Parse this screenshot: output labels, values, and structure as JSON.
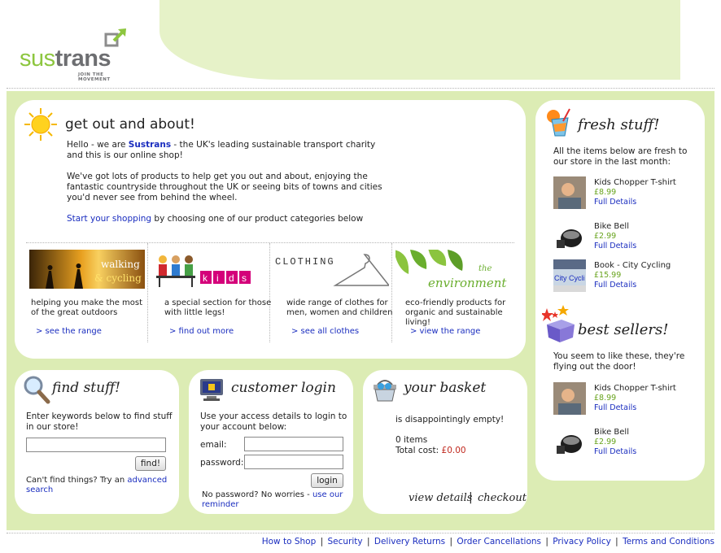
{
  "logo": {
    "part1": "sus",
    "part2": "trans",
    "tagline": "JOIN THE MOVEMENT"
  },
  "welcome": {
    "title": "get out and about!",
    "intro_prefix": "Hello - we are ",
    "intro_brand": "Sustrans",
    "intro_suffix": " - the UK's leading sustainable transport charity and this is our online shop!",
    "body": "We've got lots of products to help get you out and about, enjoying the fantastic countryside throughout the UK or seeing bits of towns and cities you'd never see from behind the wheel.",
    "cta_link": "Start your shopping",
    "cta_suffix": " by choosing one of our product categories below"
  },
  "categories": [
    {
      "image_text": "walking & cycling",
      "desc": "helping you make the most of the great outdoors",
      "link": "> see the range"
    },
    {
      "image_text": "kids",
      "desc": "a special section for those with little legs!",
      "link": "> find out more"
    },
    {
      "image_text": "CLOTHING",
      "desc": "wide range of clothes for men, women and children",
      "link": "> see all clothes"
    },
    {
      "image_text": "the environment",
      "desc": "eco-friendly products for organic and sustainable living!",
      "link": "> view the range"
    }
  ],
  "fresh": {
    "title": "fresh stuff!",
    "intro": "All the items below are fresh to our store in the last month:",
    "items": [
      {
        "name": "Kids Chopper T-shirt",
        "price": "£8.99",
        "link": "Full Details",
        "icon": "tshirt-photo"
      },
      {
        "name": "Bike Bell",
        "price": "£2.99",
        "link": "Full Details",
        "icon": "bell-photo"
      },
      {
        "name": "Book - City Cycling",
        "price": "£15.99",
        "link": "Full Details",
        "icon": "book-cover",
        "cover_text": "City Cycli"
      }
    ]
  },
  "best": {
    "title": "best sellers!",
    "intro": "You seem to like these, they're flying out the door!",
    "items": [
      {
        "name": "Kids Chopper T-shirt",
        "price": "£8.99",
        "link": "Full Details",
        "icon": "tshirt-photo"
      },
      {
        "name": "Bike Bell",
        "price": "£2.99",
        "link": "Full Details",
        "icon": "bell-photo"
      }
    ]
  },
  "find": {
    "title": "find stuff!",
    "instructions": "Enter keywords below to find stuff in our store!",
    "search_value": "",
    "button": "find!",
    "help_prefix": "Can't find things? Try an ",
    "help_link": "advanced search"
  },
  "login": {
    "title": "customer login",
    "instructions": "Use your access details to login to your account below:",
    "email_label": "email:",
    "password_label": "password:",
    "button": "login",
    "reminder_prefix": "No password? No worries - ",
    "reminder_link": "use our reminder"
  },
  "basket": {
    "title": "your basket",
    "status": "is disappointingly empty!",
    "items": "0 items",
    "total_label": "Total cost:",
    "total_value": "£0.00",
    "view_details": "view details",
    "checkout": "checkout"
  },
  "footer": [
    "How to Shop",
    "Security",
    "Delivery Returns",
    "Order Cancellations",
    "Privacy Policy",
    "Terms and Conditions"
  ],
  "colors": {
    "brand_green": "#8dc63f",
    "band": "#dcecb4",
    "link": "#1a2dbf",
    "price": "#67a31c"
  }
}
